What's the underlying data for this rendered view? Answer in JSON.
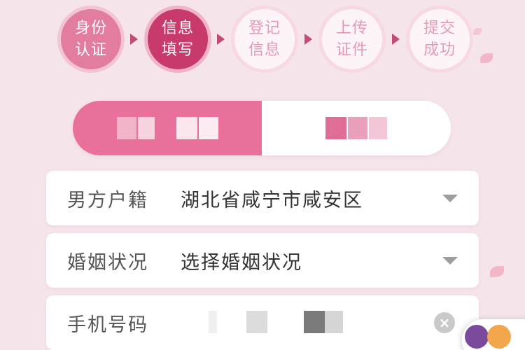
{
  "steps": [
    {
      "label": "身份\n认证",
      "state": "done"
    },
    {
      "label": "信息\n填写",
      "state": "active"
    },
    {
      "label": "登记\n信息",
      "state": "todo"
    },
    {
      "label": "上传\n证件",
      "state": "todo"
    },
    {
      "label": "提交\n成功",
      "state": "todo"
    }
  ],
  "toggle": {
    "left_state": "selected",
    "right_state": "unselected"
  },
  "form": {
    "hukou": {
      "label": "男方户籍",
      "value": "湖北省咸宁市咸安区"
    },
    "marital": {
      "label": "婚姻状况",
      "value": "选择婚姻状况"
    },
    "phone": {
      "label": "手机号码",
      "value": ""
    }
  },
  "icons": {
    "dropdown": "chevron-down-icon",
    "clear": "clear-icon"
  },
  "colors": {
    "accent": "#e8709b",
    "active_step": "#c83a6c",
    "background": "#f5e4ea"
  }
}
